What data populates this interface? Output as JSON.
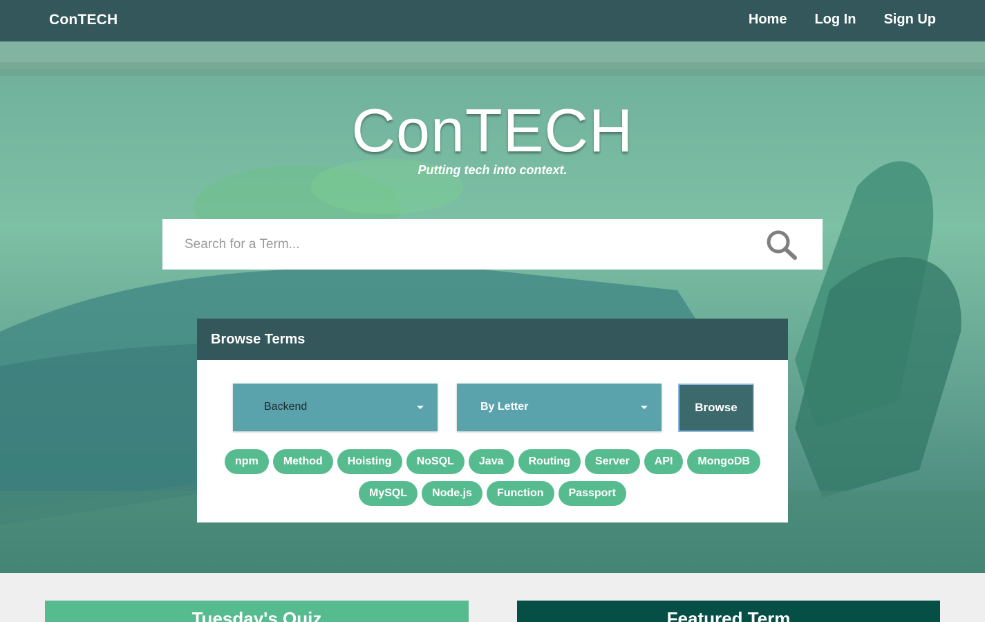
{
  "navbar": {
    "brand": "ConTECH",
    "links": [
      "Home",
      "Log In",
      "Sign Up"
    ]
  },
  "hero": {
    "title": "ConTECH",
    "tagline": "Putting tech into context."
  },
  "search": {
    "placeholder": "Search for a Term...",
    "icon": "search-icon"
  },
  "browse": {
    "header": "Browse Terms",
    "category_select": "Backend",
    "order_select": "By Letter",
    "button": "Browse",
    "tags_row1": [
      "npm",
      "Method",
      "Hoisting",
      "NoSQL",
      "Java",
      "Routing",
      "Server",
      "API",
      "MongoDB"
    ],
    "tags_row2": [
      "MySQL",
      "Node.js",
      "Function",
      "Passport"
    ]
  },
  "cards": {
    "quiz_title": "Tuesday's Quiz",
    "featured_title": "Featured Term"
  },
  "colors": {
    "navbar": "#33575b",
    "tag": "#56bc8f",
    "select": "#5aa3ad",
    "featured": "#064f46"
  }
}
